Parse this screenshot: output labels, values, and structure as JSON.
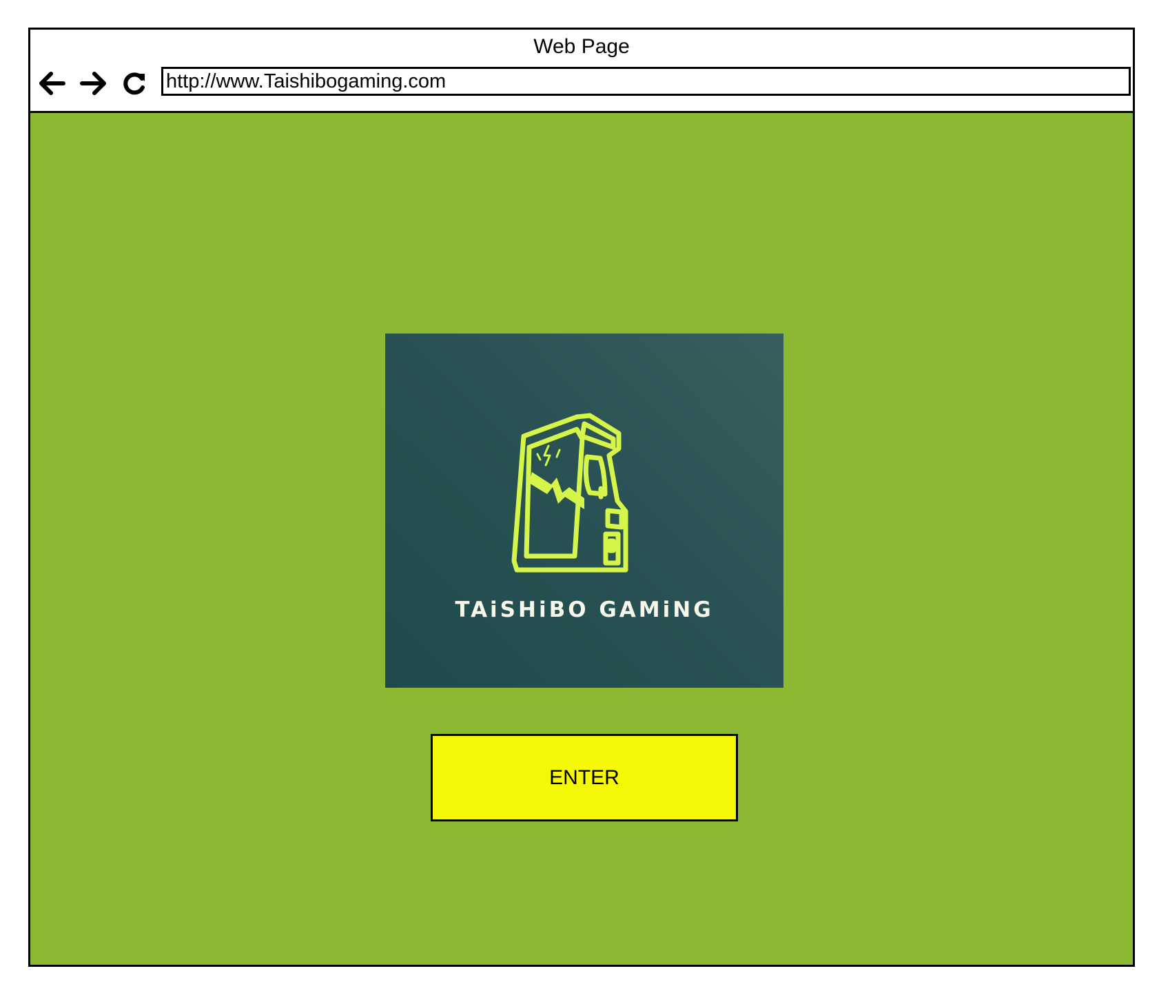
{
  "window": {
    "title": "Web Page"
  },
  "toolbar": {
    "back_icon": "arrow-left-icon",
    "forward_icon": "arrow-right-icon",
    "reload_icon": "reload-icon",
    "url": "http://www.Taishibogaming.com"
  },
  "main": {
    "background_color": "#8cb832",
    "logo": {
      "icon": "arcade-cabinet-icon",
      "text": "TAiSHiBO GAMiNG",
      "accent_color": "#d6f54a",
      "background_color": "#2a5254"
    },
    "enter_button": {
      "label": "ENTER",
      "color": "#f5f806"
    }
  }
}
